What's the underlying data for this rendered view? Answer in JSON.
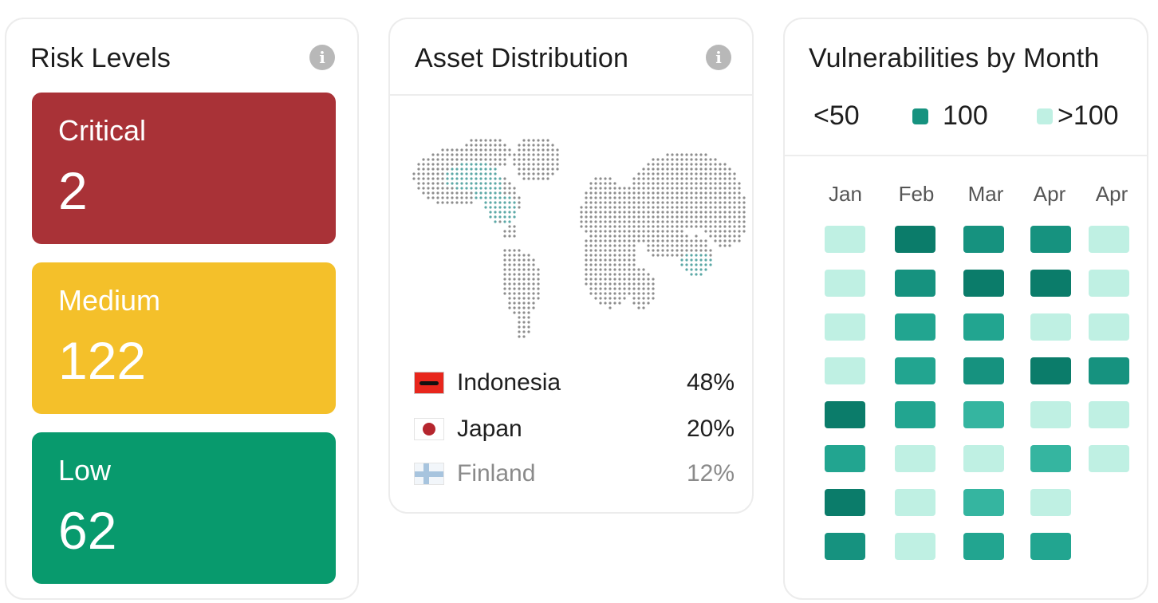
{
  "risk": {
    "title": "Risk Levels",
    "levels": [
      {
        "label": "Critical",
        "value": "2",
        "color": "#a93237"
      },
      {
        "label": "Medium",
        "value": "122",
        "color": "#f4c02a"
      },
      {
        "label": "Low",
        "value": "62",
        "color": "#089a6d"
      }
    ]
  },
  "asset": {
    "title": "Asset Distribution",
    "countries": [
      {
        "name": "Indonesia",
        "percent": "48%"
      },
      {
        "name": "Japan",
        "percent": "20%"
      },
      {
        "name": "Finland",
        "percent": "12%"
      }
    ]
  },
  "vulnerabilities": {
    "title": "Vulnerabilities by Month",
    "legend": [
      {
        "label": "<50",
        "color": "#ffffff"
      },
      {
        "label": "100",
        "color": "#16927f"
      },
      {
        "label": ">100",
        "color": "#bff0e3"
      }
    ],
    "months": [
      "Jan",
      "Feb",
      "Mar",
      "Apr",
      "Apr"
    ],
    "grid_levels": [
      [
        0,
        4,
        3,
        3,
        0
      ],
      [
        0,
        3,
        4,
        4,
        0
      ],
      [
        0,
        2,
        2,
        0,
        0
      ],
      [
        0,
        2,
        3,
        4,
        3
      ],
      [
        4,
        2,
        1,
        0,
        0
      ],
      [
        2,
        0,
        0,
        1,
        0
      ],
      [
        4,
        0,
        1,
        0,
        null
      ],
      [
        3,
        0,
        2,
        2,
        null
      ]
    ],
    "level_colors": [
      "#bff0e3",
      "#35b5a0",
      "#22a590",
      "#16927f",
      "#0b7c6a"
    ]
  }
}
